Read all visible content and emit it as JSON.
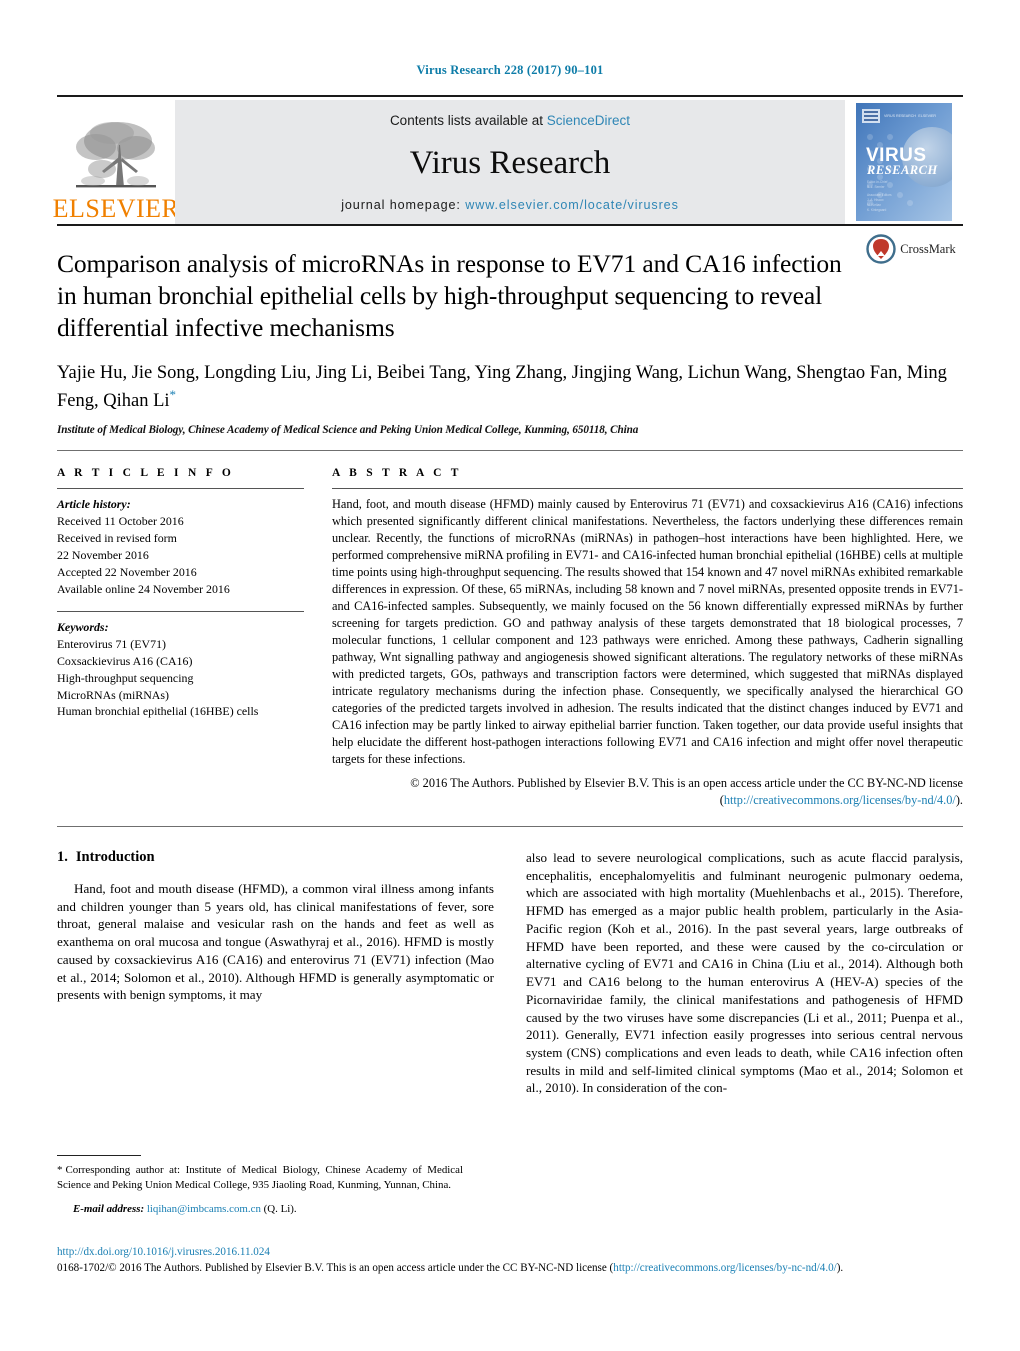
{
  "running_head": "Virus Research 228 (2017) 90–101",
  "banner": {
    "contents_prefix": "Contents lists available at ",
    "sciencedirect": "ScienceDirect",
    "journal_name": "Virus Research",
    "homepage_prefix": "journal homepage: ",
    "homepage_url": "www.elsevier.com/locate/virusres",
    "publisher_logo_word": "ELSEVIER",
    "publisher_logo_icon": "elsevier-tree-icon",
    "cover_title_line1": "VIRUS",
    "cover_title_line2": "RESEARCH"
  },
  "article": {
    "title": "Comparison analysis of microRNAs in response to EV71 and CA16 infection in human bronchial epithelial cells by high-throughput sequencing to reveal differential infective mechanisms",
    "crossmark_label": "CrossMark",
    "authors": "Yajie Hu, Jie Song, Longding Liu, Jing Li, Beibei Tang, Ying Zhang, Jingjing Wang, Lichun Wang, Shengtao Fan, Ming Feng, Qihan Li",
    "corresponding_marker": "*",
    "affiliation": "Institute of Medical Biology, Chinese Academy of Medical Science and Peking Union Medical College, Kunming, 650118, China"
  },
  "article_info": {
    "heading": "A R T I C L E   I N F O",
    "history_label": "Article history:",
    "history": [
      "Received 11 October 2016",
      "Received in revised form",
      "22 November 2016",
      "Accepted 22 November 2016",
      "Available online 24 November 2016"
    ],
    "keywords_label": "Keywords:",
    "keywords": [
      "Enterovirus 71 (EV71)",
      "Coxsackievirus A16 (CA16)",
      "High-throughput sequencing",
      "MicroRNAs (miRNAs)",
      "Human bronchial epithelial (16HBE) cells"
    ]
  },
  "abstract": {
    "heading": "A B S T R A C T",
    "text": "Hand, foot, and mouth disease (HFMD) mainly caused by Enterovirus 71 (EV71) and coxsackievirus A16 (CA16) infections which presented significantly different clinical manifestations. Nevertheless, the factors underlying these differences remain unclear. Recently, the functions of microRNAs (miRNAs) in pathogen–host interactions have been highlighted. Here, we performed comprehensive miRNA profiling in EV71- and CA16-infected human bronchial epithelial (16HBE) cells at multiple time points using high-throughput sequencing. The results showed that 154 known and 47 novel miRNAs exhibited remarkable differences in expression. Of these, 65 miRNAs, including 58 known and 7 novel miRNAs, presented opposite trends in EV71- and CA16-infected samples. Subsequently, we mainly focused on the 56 known differentially expressed miRNAs by further screening for targets prediction. GO and pathway analysis of these targets demonstrated that 18 biological processes, 7 molecular functions, 1 cellular component and 123 pathways were enriched. Among these pathways, Cadherin signalling pathway, Wnt signalling pathway and angiogenesis showed significant alterations. The regulatory networks of these miRNAs with predicted targets, GOs, pathways and transcription factors were determined, which suggested that miRNAs displayed intricate regulatory mechanisms during the infection phase. Consequently, we specifically analysed the hierarchical GO categories of the predicted targets involved in adhesion. The results indicated that the distinct changes induced by EV71 and CA16 infection may be partly linked to airway epithelial barrier function. Taken together, our data provide useful insights that help elucidate the different host-pathogen interactions following EV71 and CA16 infection and might offer novel therapeutic targets for these infections.",
    "copyright_line1": "© 2016 The Authors. Published by Elsevier B.V. This is an open access article under the CC BY-NC-ND",
    "copyright_line2_prefix": "license (",
    "copyright_license_url": "http://creativecommons.org/licenses/by-nd/4.0/",
    "copyright_line2_suffix": ")."
  },
  "introduction": {
    "number": "1.",
    "heading": "Introduction",
    "left_paragraph": "Hand, foot and mouth disease (HFMD), a common viral illness among infants and children younger than 5 years old, has clinical manifestations of fever, sore throat, general malaise and vesicular rash on the hands and feet as well as exanthema on oral mucosa and tongue (Aswathyraj et al., 2016). HFMD is mostly caused by coxsackievirus A16 (CA16) and enterovirus 71 (EV71) infection (Mao et al., 2014; Solomon et al., 2010). Although HFMD is generally asymptomatic or presents with benign symptoms, it may",
    "right_paragraph": "also lead to severe neurological complications, such as acute flaccid paralysis, encephalitis, encephalomyelitis and fulminant neurogenic pulmonary oedema, which are associated with high mortality (Muehlenbachs et al., 2015). Therefore, HFMD has emerged as a major public health problem, particularly in the Asia-Pacific region (Koh et al., 2016). In the past several years, large outbreaks of HFMD have been reported, and these were caused by the co-circulation or alternative cycling of EV71 and CA16 in China (Liu et al., 2014). Although both EV71 and CA16 belong to the human enterovirus A (HEV-A) species of the Picornaviridae family, the clinical manifestations and pathogenesis of HFMD caused by the two viruses have some discrepancies (Li et al., 2011; Puenpa et al., 2011). Generally, EV71 infection easily progresses into serious central nervous system (CNS) complications and even leads to death, while CA16 infection often results in mild and self-limited clinical symptoms (Mao et al., 2014; Solomon et al., 2010). In consideration of the con-",
    "citations_left": [
      "Aswathyraj et al., 2016",
      "Mao et al., 2014; Solomon et al., 2010"
    ],
    "citations_right": [
      "Muehlenbachs et al., 2015",
      "Koh et al., 2016",
      "Liu et al., 2014",
      "Li et al., 2011; Puenpa et al., 2011",
      "Mao et al., 2014; Solomon et al., 2010"
    ]
  },
  "footnotes": {
    "corresponding_marker": "*",
    "corresponding_text": "Corresponding author at: Institute of Medical Biology, Chinese Academy of Medical Science and Peking Union Medical College, 935 Jiaoling Road, Kunming, Yunnan, China.",
    "email_label": "E-mail address:",
    "email": "liqihan@imbcams.com.cn",
    "email_owner": "(Q. Li)."
  },
  "footer": {
    "doi": "http://dx.doi.org/10.1016/j.virusres.2016.11.024",
    "issn_line": "0168-1702/© 2016 The Authors. Published by Elsevier B.V. This is an open access article under the CC BY-NC-ND license (",
    "license_url": "http://creativecommons.org/licenses/by-nc-nd/4.0/",
    "issn_line_suffix": ")."
  },
  "colors": {
    "link": "#1a7fb3",
    "sciencedirect": "#2f86b5",
    "elsevier_orange": "#f08000",
    "banner_bg": "#e7e8ea"
  }
}
